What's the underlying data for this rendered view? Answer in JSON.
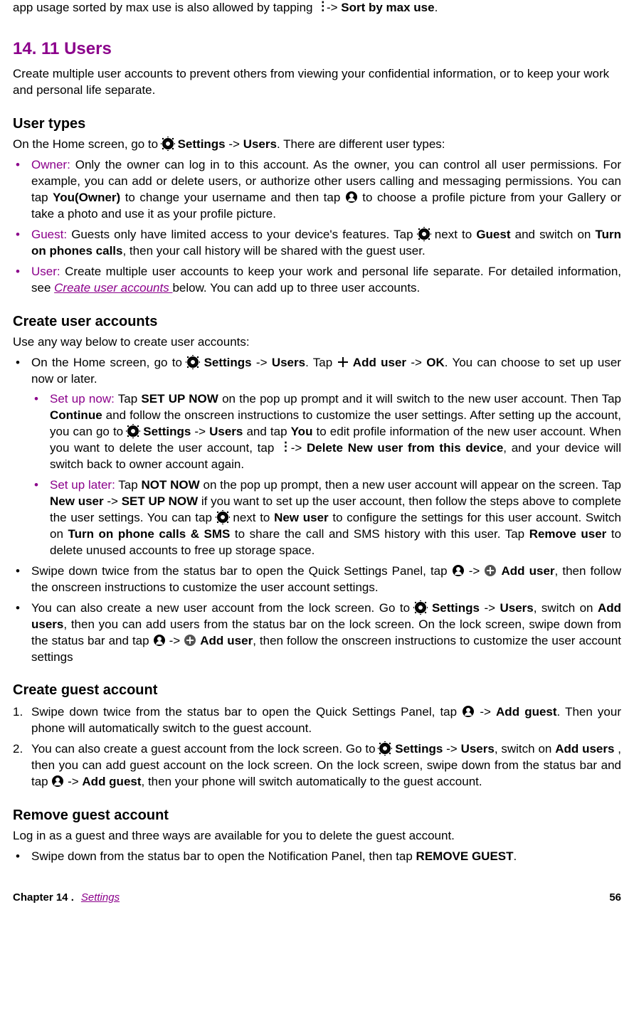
{
  "pre": {
    "t1": "app usage sorted by max use is also allowed by tapping ",
    "t2": " -> ",
    "b1": "Sort by max use",
    "t3": "."
  },
  "section_title": "14. 11  Users",
  "intro": "Create multiple user accounts to prevent others from viewing your confidential information, or to keep your work and personal life separate.",
  "user_types": {
    "heading": "User types",
    "lead1": "On the Home screen, go to ",
    "settings": "Settings",
    "arrow": " -> ",
    "users": "Users",
    "lead2": ". There are different user types:",
    "owner_label": "Owner:",
    "owner1": " Only the owner can log in to this account. As the owner, you can control all user permissions. For example, you can add or delete users, or authorize other users calling and messaging permissions. You can tap ",
    "owner_you": "You(Owner)",
    "owner2": " to change your username and then tap ",
    "owner3": " to choose a profile picture from your Gallery or take a photo and use it as your profile picture.",
    "guest_label": "Guest:",
    "guest1": " Guests only have limited access to your device's features. Tap ",
    "guest2": " next to ",
    "guest_b": "Guest",
    "guest3": " and switch on ",
    "guest_turn": "Turn on phones calls",
    "guest4": ", then your call history will be shared with the guest user.",
    "user_label": "User:",
    "user1": " Create multiple user accounts to keep your work and personal life separate. For detailed information, see ",
    "user_link": "Create user accounts ",
    "user2": "below. You can add up to three user accounts."
  },
  "create_user": {
    "heading": "Create user accounts",
    "lead": "Use any way below to create user accounts:",
    "b1_1": "On the Home screen, go to ",
    "settings": "Settings",
    "arrow": " -> ",
    "users": "Users",
    "b1_2": ". Tap ",
    "add_user": "Add user",
    "ok": "OK",
    "b1_3": ". You can choose to set up user now or later.",
    "now_label": "Set up now:",
    "now1": " Tap ",
    "now_setup": "SET UP NOW",
    "now2": " on the pop up prompt and it will switch to the new user account. Then Tap ",
    "now_continue": "Continue",
    "now3": " and follow the onscreen instructions to customize the user settings. After setting up the account, you can go to ",
    "now4": " and tap ",
    "now_you": "You",
    "now5": " to edit profile information of the new user account. When you want to delete the user account, tap ",
    "now6": " -> ",
    "now_delete": "Delete New user from this device",
    "now7": ", and your device will switch back to owner account again.",
    "later_label": "Set up later:",
    "later1": " Tap ",
    "later_not": "NOT NOW",
    "later2": " on the pop up prompt, then a new user account will appear on the screen. Tap ",
    "later_new": "New user",
    "later3": " -> ",
    "later_setup": "SET UP NOW",
    "later4": " if you want to set up the user account, then follow the steps above to complete the user settings. You can tap ",
    "later5": " next to ",
    "later6": " to configure the settings for this user account. Switch on ",
    "later_turn": "Turn on phone calls & SMS",
    "later7": " to share the call and SMS history with this user. Tap ",
    "later_remove": "Remove user",
    "later8": " to delete unused accounts to free up storage space.",
    "b2_1": "Swipe down twice from the status bar to open the Quick Settings Panel, tap ",
    "b2_2": " -> ",
    "b2_3": ", then follow the  onscreen instructions to customize the user account settings.",
    "b3_1": "You can also create a new user account from the lock screen. Go to ",
    "b3_2": ", switch on ",
    "b3_addusers": "Add users",
    "b3_3": ", then you can add users from the status bar on the lock screen. On the lock screen, swipe down from the status bar and tap ",
    "b3_4": " -> ",
    "b3_5": ", then follow the  onscreen instructions to customize the user account settings"
  },
  "create_guest": {
    "heading": "Create guest account",
    "n1_1": "Swipe down twice from the status bar to open the Quick Settings Panel, tap ",
    "n1_2": " -> ",
    "n1_addguest": "Add guest",
    "n1_3": ". Then your phone will automatically switch to the guest account.",
    "n2_1": "You can also create a guest account from the lock screen. Go to ",
    "settings": "Settings",
    "arrow": " -> ",
    "users": "Users",
    "n2_2": ", switch on ",
    "n2_addusers": "Add users",
    "n2_3": " , then you can add guest account on the lock screen. On the lock screen, swipe down from the status bar and tap ",
    "n2_4": " -> ",
    "n2_5": ", then your phone will switch automatically to the guest account."
  },
  "remove_guest": {
    "heading": "Remove guest account",
    "lead": "Log in as a guest and three ways are available for you to delete the guest account.",
    "b1_1": "Swipe down from the status bar to open the Notification Panel, then tap ",
    "b1_remove": "REMOVE GUEST",
    "b1_2": "."
  },
  "footer": {
    "chapter": "Chapter 14 .",
    "link": "Settings",
    "page": "56"
  }
}
